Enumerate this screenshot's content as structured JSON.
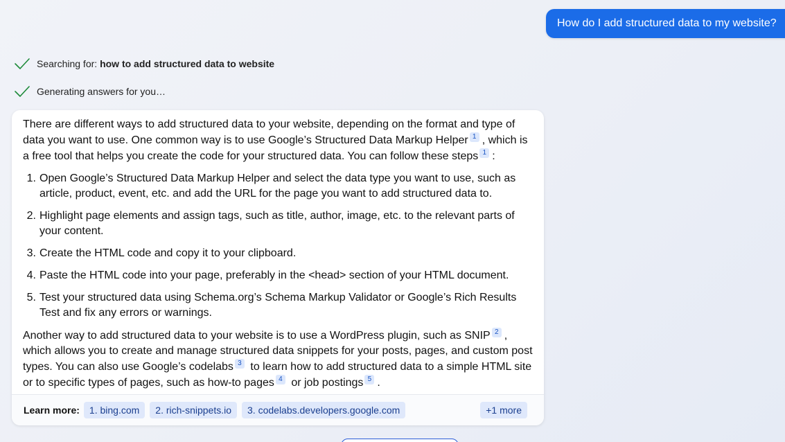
{
  "user_message": "How do I add structured data to my website?",
  "status": {
    "searching_prefix": "Searching for: ",
    "searching_query": "how to add structured data to website",
    "generating": "Generating answers for you…"
  },
  "answer": {
    "intro_1": "There are different ways to add structured data to your website, depending on the format and type of data you want to use. One common way is to use Google’s Structured Data Markup Helper",
    "intro_cite_1": "1",
    "intro_2": ", which is a free tool that helps you create the code for your structured data. You can follow these steps",
    "intro_cite_2": "1",
    "intro_3": ":",
    "steps": [
      {
        "num": "1.",
        "text": "Open Google’s Structured Data Markup Helper and select the data type you want to use, such as article, product, event, etc. and add the URL for the page you want to add structured data to."
      },
      {
        "num": "2.",
        "text": "Highlight page elements and assign tags, such as title, author, image, etc. to the relevant parts of your content."
      },
      {
        "num": "3.",
        "text": "Create the HTML code and copy it to your clipboard."
      },
      {
        "num": "4.",
        "text": "Paste the HTML code into your page, preferably in the <head> section of your HTML document."
      },
      {
        "num": "5.",
        "text": "Test your structured data using Schema.org’s Schema Markup Validator or Google’s Rich Results Test and fix any errors or warnings."
      }
    ],
    "outro_1": "Another way to add structured data to your website is to use a WordPress plugin, such as SNIP",
    "outro_cite_1": "2",
    "outro_2": ", which allows you to create and manage structured data snippets for your posts, pages, and custom post types. You can also use Google’s codelabs",
    "outro_cite_2": "3",
    "outro_3": " to learn how to add structured data to a simple HTML site or to specific types of pages, such as how-to pages",
    "outro_cite_3": "4",
    "outro_4": " or job postings",
    "outro_cite_4": "5",
    "outro_5": "."
  },
  "learn_more": {
    "label": "Learn more:",
    "sources": [
      "1. bing.com",
      "2. rich-snippets.io",
      "3. codelabs.developers.google.com"
    ],
    "more": "+1 more"
  },
  "colors": {
    "accent": "#1b6ce8",
    "check": "#1e8a3a",
    "chip_bg": "#dfe8fb"
  }
}
